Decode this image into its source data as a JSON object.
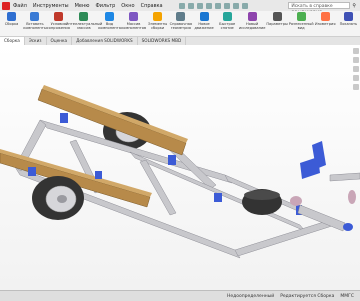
{
  "menu": {
    "items": [
      "Файл",
      "Инструменты",
      "Меню",
      "Фильтр",
      "Окно",
      "Справка"
    ],
    "search_placeholder": "Искать в справке SOLIDWORKS"
  },
  "ribbon": {
    "buttons": [
      "Сборка",
      "Вставить компоненты",
      "Условия сопряжения",
      "Интеллектуальный массив",
      "Вид компонента",
      "Массив компонентов",
      "Элементы сборки",
      "Справочная геометрия",
      "Новое движение",
      "Быстрое снятие",
      "Новый исследование",
      "Параметры",
      "Разнесенный вид",
      "Изометрия",
      "Показать"
    ],
    "colors": [
      "#2f6fd1",
      "#3a7bd5",
      "#c0392b",
      "#2e8b57",
      "#1e88e5",
      "#7e57c2",
      "#f4a300",
      "#607d8b",
      "#1976d2",
      "#26a69a",
      "#8e44ad",
      "#555555",
      "#4caf50",
      "#ff7043",
      "#3f51b5"
    ]
  },
  "tabs": [
    "Сборка",
    "Эскиз",
    "Оценка",
    "Добавления SOLIDWORKS",
    "SOLIDWORKS MBD"
  ],
  "status": {
    "state": "Недоопределенный",
    "mode": "Редактируется Сборка",
    "units": "ММГС"
  },
  "colors": {
    "frame": "#c8c8cc",
    "frame_dark": "#8e8e96",
    "wood": "#b78a4a",
    "tire": "#3a3a3a",
    "bracket": "#3c5bd6",
    "roller": "#c9a6b7"
  }
}
